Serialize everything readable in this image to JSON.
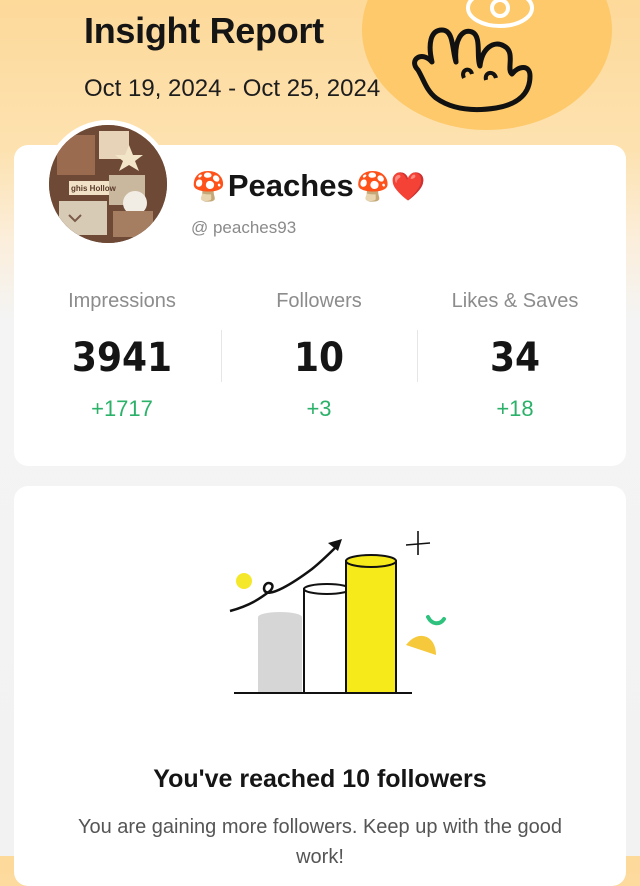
{
  "header": {
    "title": "Insight Report",
    "date_range": "Oct 19, 2024 - Oct 25, 2024"
  },
  "profile": {
    "name_prefix_emoji": "🍄",
    "name": "Peaches",
    "name_suffix_emoji": "🍄❤️",
    "handle": "@ peaches93",
    "avatar_text": "ghis Hollow"
  },
  "stats": [
    {
      "label": "Impressions",
      "value": "3941",
      "delta": "+1717"
    },
    {
      "label": "Followers",
      "value": "10",
      "delta": "+3"
    },
    {
      "label": "Likes & Saves",
      "value": "34",
      "delta": "+18"
    }
  ],
  "milestone": {
    "title": "You've reached 10 followers",
    "text": "You are gaining more followers. Keep up with the good work!"
  },
  "colors": {
    "accent_orange": "#fdc96a",
    "delta_green": "#2bb169",
    "bar_yellow": "#f7ea1a"
  }
}
